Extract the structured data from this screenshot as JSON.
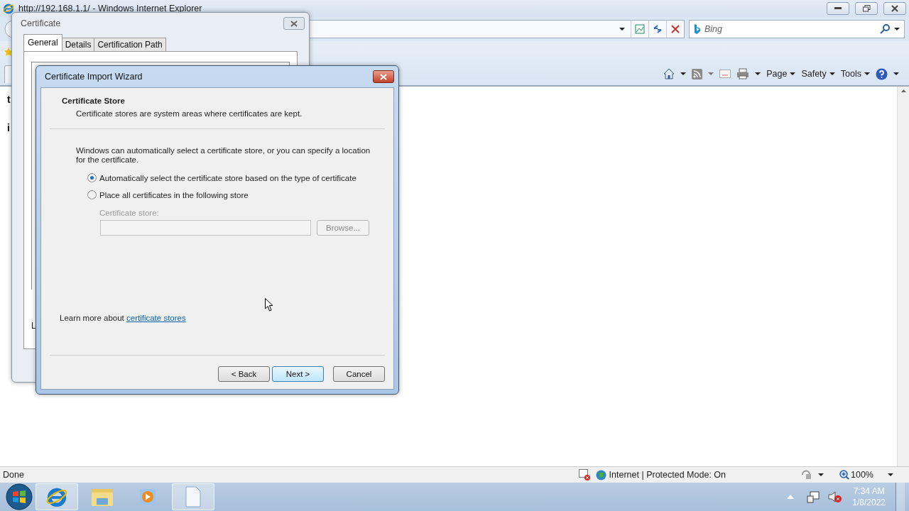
{
  "browser": {
    "title": "http://192.168.1.1/ - Windows Internet Explorer",
    "search": {
      "placeholder": "Bing"
    },
    "menus": [
      {
        "label": "Page"
      },
      {
        "label": "Safety"
      },
      {
        "label": "Tools"
      }
    ],
    "page_fragments": [
      "t",
      "i"
    ]
  },
  "certificate_dialog": {
    "title": "Certificate",
    "tabs": [
      {
        "label": "General",
        "selected": true
      },
      {
        "label": "Details",
        "selected": false
      },
      {
        "label": "Certification Path",
        "selected": false
      }
    ],
    "fragment": "L"
  },
  "wizard": {
    "title": "Certificate Import Wizard",
    "heading": "Certificate Store",
    "subheading": "Certificate stores are system areas where certificates are kept.",
    "intro": "Windows can automatically select a certificate store, or you can specify a location for the certificate.",
    "options": [
      {
        "label": "Automatically select the certificate store based on the type of certificate",
        "selected": true
      },
      {
        "label": "Place all certificates in the following store",
        "selected": false
      }
    ],
    "store": {
      "label": "Certificate store:",
      "disabled": true,
      "browse": "Browse..."
    },
    "learn_more": "Learn more about",
    "link": "certificate stores",
    "buttons": [
      {
        "label": "< Back",
        "default": false
      },
      {
        "label": "Next >",
        "default": true
      },
      {
        "label": "Cancel",
        "default": false
      }
    ]
  },
  "status_bar": {
    "text": "Done",
    "zone": "Internet | Protected Mode: On",
    "zoom": "100%"
  },
  "taskbar": {
    "buttons": [
      {
        "kind": "browser",
        "highlighted": true
      },
      {
        "kind": "folder",
        "highlighted": false
      },
      {
        "kind": "media",
        "highlighted": false
      },
      {
        "kind": "document",
        "highlighted": true
      }
    ],
    "time": "7:34 AM",
    "date": "1/8/2022"
  }
}
